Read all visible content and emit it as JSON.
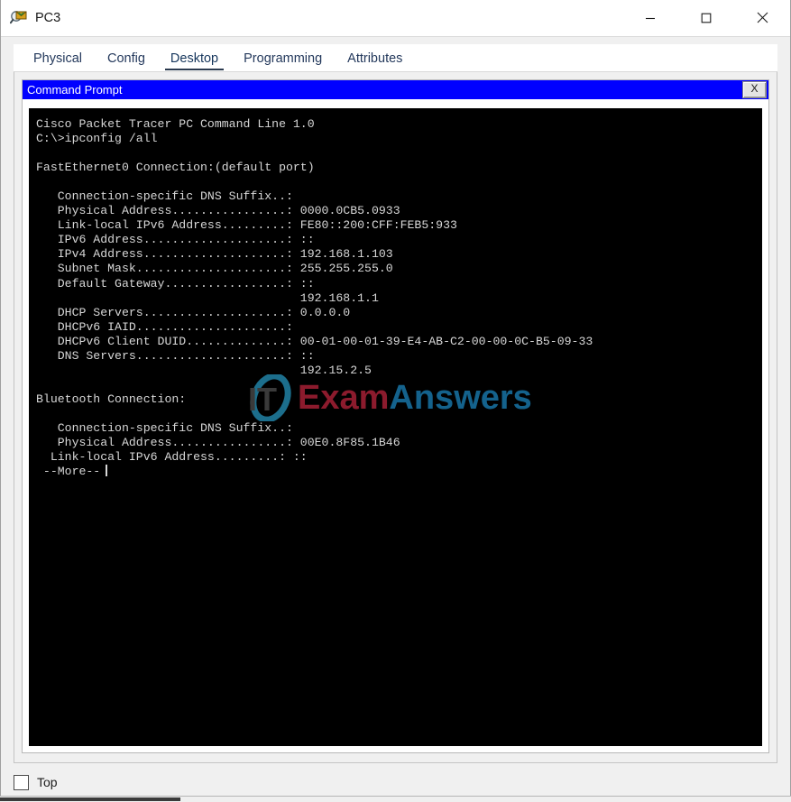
{
  "window": {
    "title": "PC3",
    "icon": "packet-tracer-pc-icon",
    "controls": {
      "minimize": "minimize-icon",
      "maximize": "maximize-icon",
      "close": "close-icon"
    }
  },
  "tabs": [
    {
      "label": "Physical",
      "active": false
    },
    {
      "label": "Config",
      "active": false
    },
    {
      "label": "Desktop",
      "active": true
    },
    {
      "label": "Programming",
      "active": false
    },
    {
      "label": "Attributes",
      "active": false
    }
  ],
  "command_prompt": {
    "title": "Command Prompt",
    "close_label": "X",
    "title_bg": "#0000FF",
    "terminal_bg": "#000000",
    "terminal_fg": "#D7D7D7",
    "lines": [
      "Cisco Packet Tracer PC Command Line 1.0",
      "C:\\>ipconfig /all",
      "",
      "FastEthernet0 Connection:(default port)",
      "",
      "   Connection-specific DNS Suffix..:",
      "   Physical Address................: 0000.0CB5.0933",
      "   Link-local IPv6 Address.........: FE80::200:CFF:FEB5:933",
      "   IPv6 Address....................: ::",
      "   IPv4 Address....................: 192.168.1.103",
      "   Subnet Mask.....................: 255.255.255.0",
      "   Default Gateway.................: ::",
      "                                     192.168.1.1",
      "   DHCP Servers....................: 0.0.0.0",
      "   DHCPv6 IAID.....................:",
      "   DHCPv6 Client DUID..............: 00-01-00-01-39-E4-AB-C2-00-00-0C-B5-09-33",
      "   DNS Servers.....................: ::",
      "                                     192.15.2.5",
      "",
      "Bluetooth Connection:",
      "",
      "   Connection-specific DNS Suffix..:",
      "   Physical Address................: 00E0.8F85.1B46",
      "  Link-local IPv6 Address.........: ::"
    ],
    "more_prompt": " --More--"
  },
  "watermark": {
    "mark": "IT",
    "part1": "Exam",
    "part2": "Answers",
    "part1_color": "#8C1B2D",
    "part2_color": "#14628C",
    "mark_color": "#3A3A3A",
    "ring_color": "#1C6E8C"
  },
  "bottom": {
    "checkbox_label": "Top",
    "checked": false
  }
}
